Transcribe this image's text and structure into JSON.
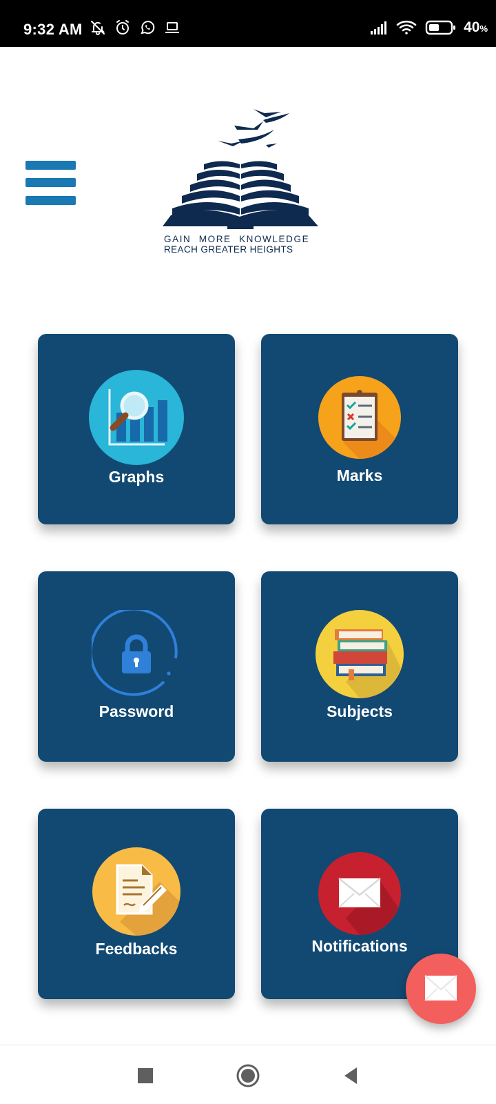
{
  "status_bar": {
    "time": "9:32 AM",
    "battery_percent": "40",
    "battery_unit": "%",
    "left_icons": [
      "bell-off-icon",
      "alarm-icon",
      "whatsapp-icon",
      "laptop-icon"
    ],
    "right_icons": [
      "signal-icon",
      "wifi-icon",
      "battery-icon"
    ]
  },
  "header": {
    "menu_icon": "hamburger-menu-icon",
    "logo": {
      "line1": "GAIN  MORE  KNOWLEDGE",
      "line2": "REACH GREATER HEIGHTS"
    }
  },
  "tiles": [
    {
      "label": "Graphs",
      "icon": "graph-magnifier-icon",
      "icon_color": "#29b6d8"
    },
    {
      "label": "Marks",
      "icon": "checklist-icon",
      "icon_color": "#f7a21b"
    },
    {
      "label": "Password",
      "icon": "lock-icon",
      "icon_color": "#2f80d9"
    },
    {
      "label": "Subjects",
      "icon": "books-icon",
      "icon_color": "#f4d03f"
    },
    {
      "label": "Feedbacks",
      "icon": "feedback-form-icon",
      "icon_color": "#f8bb46"
    },
    {
      "label": "Notifications",
      "icon": "envelope-icon",
      "icon_color": "#c7202f"
    }
  ],
  "fab": {
    "icon": "mail-icon",
    "color": "#f25f5c"
  },
  "nav_bar": {
    "icons": [
      "recents-square-icon",
      "home-circle-icon",
      "back-triangle-icon"
    ]
  },
  "colors": {
    "tile_background": "#124973",
    "menu_icon": "#1a78b2",
    "logo": "#0e2a4f"
  }
}
